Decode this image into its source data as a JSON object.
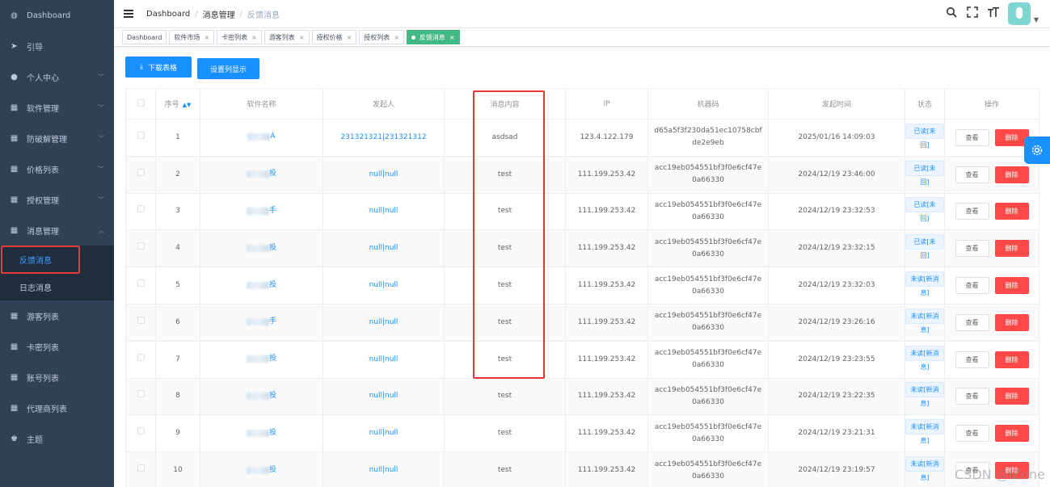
{
  "sidebar": {
    "items": [
      {
        "label": "Dashboard",
        "icon": "dashboard-icon",
        "glyph": "◍"
      },
      {
        "label": "引导",
        "icon": "guide-icon",
        "glyph": "➤"
      },
      {
        "label": "个人中心",
        "icon": "user-icon",
        "glyph": "●"
      },
      {
        "label": "软件管理",
        "icon": "grid-icon",
        "glyph": "▦"
      },
      {
        "label": "防破解管理",
        "icon": "grid-icon",
        "glyph": "▦"
      },
      {
        "label": "价格列表",
        "icon": "grid-icon",
        "glyph": "▦"
      },
      {
        "label": "授权管理",
        "icon": "grid-icon",
        "glyph": "▦"
      },
      {
        "label": "消息管理",
        "icon": "grid-icon",
        "glyph": "▦"
      }
    ],
    "sub_items": [
      {
        "label": "反馈消息"
      },
      {
        "label": "日志消息"
      }
    ],
    "items_after": [
      {
        "label": "游客列表",
        "glyph": "▦"
      },
      {
        "label": "卡密列表",
        "glyph": "▦"
      },
      {
        "label": "账号列表",
        "glyph": "▦"
      },
      {
        "label": "代理商列表",
        "glyph": "▦"
      },
      {
        "label": "主题",
        "glyph": "♚"
      }
    ]
  },
  "breadcrumb": [
    "Dashboard",
    "消息管理",
    "反馈消息"
  ],
  "tags": [
    "Dashboard",
    "软件市场",
    "卡密列表",
    "游客列表",
    "授权价格",
    "授权列表",
    "反馈消息"
  ],
  "toolbar": {
    "download_label": "下载表格",
    "columns_label": "设置列显示"
  },
  "table": {
    "headers": [
      "序号",
      "软件名称",
      "发起人",
      "消息内容",
      "IP",
      "机器码",
      "发起时间",
      "状态",
      "操作"
    ],
    "view_label": "查看",
    "delete_label": "删除",
    "rows": [
      {
        "index": "1",
        "name_suffix": "A",
        "sender": "231321321|231321312",
        "content": "asdsad",
        "ip": "123.4.122.179",
        "machine": "d65a5f3f230da51ec10758cbfde2e9eb",
        "time": "2025/01/16 14:09:03",
        "status": "已读[未回]"
      },
      {
        "index": "2",
        "name_suffix": "投",
        "sender": "null|null",
        "content": "test",
        "ip": "111.199.253.42",
        "machine": "acc19eb054551bf3f0e6cf47e0a66330",
        "time": "2024/12/19 23:46:00",
        "status": "已读[未回]"
      },
      {
        "index": "3",
        "name_suffix": "手",
        "sender": "null|null",
        "content": "test",
        "ip": "111.199.253.42",
        "machine": "acc19eb054551bf3f0e6cf47e0a66330",
        "time": "2024/12/19 23:32:53",
        "status": "已读[未回]"
      },
      {
        "index": "4",
        "name_suffix": "投",
        "sender": "null|null",
        "content": "test",
        "ip": "111.199.253.42",
        "machine": "acc19eb054551bf3f0e6cf47e0a66330",
        "time": "2024/12/19 23:32:15",
        "status": "已读[未回]"
      },
      {
        "index": "5",
        "name_suffix": "投",
        "sender": "null|null",
        "content": "test",
        "ip": "111.199.253.42",
        "machine": "acc19eb054551bf3f0e6cf47e0a66330",
        "time": "2024/12/19 23:32:03",
        "status": "未读[新消息]"
      },
      {
        "index": "6",
        "name_suffix": "手",
        "sender": "null|null",
        "content": "test",
        "ip": "111.199.253.42",
        "machine": "acc19eb054551bf3f0e6cf47e0a66330",
        "time": "2024/12/19 23:26:16",
        "status": "未读[新消息]"
      },
      {
        "index": "7",
        "name_suffix": "投",
        "sender": "null|null",
        "content": "test",
        "ip": "111.199.253.42",
        "machine": "acc19eb054551bf3f0e6cf47e0a66330",
        "time": "2024/12/19 23:23:55",
        "status": "未读[新消息]"
      },
      {
        "index": "8",
        "name_suffix": "投",
        "sender": "null|null",
        "content": "test",
        "ip": "111.199.253.42",
        "machine": "acc19eb054551bf3f0e6cf47e0a66330",
        "time": "2024/12/19 23:22:35",
        "status": "未读[新消息]"
      },
      {
        "index": "9",
        "name_suffix": "投",
        "sender": "null|null",
        "content": "test",
        "ip": "111.199.253.42",
        "machine": "acc19eb054551bf3f0e6cf47e0a66330",
        "time": "2024/12/19 23:21:31",
        "status": "未读[新消息]"
      },
      {
        "index": "10",
        "name_suffix": "投",
        "sender": "null|null",
        "content": "test",
        "ip": "111.199.253.42",
        "machine": "acc19eb054551bf3f0e6cf47e0a66330",
        "time": "2024/12/19 23:19:57",
        "status": "未读[新消息]"
      }
    ]
  },
  "watermark": "CSDN @lZone",
  "colors": {
    "primary": "#1890ff",
    "danger": "#ff4949",
    "sidebar": "#304156",
    "tag_active": "#42b983",
    "highlight": "#e53935"
  }
}
